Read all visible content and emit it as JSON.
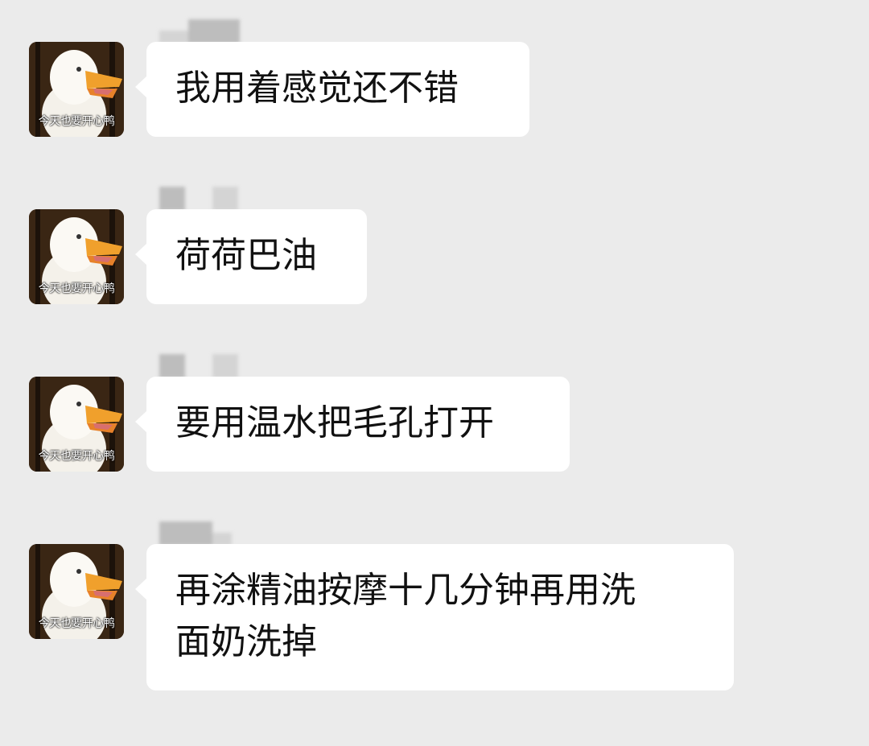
{
  "chat": {
    "messages": [
      {
        "avatar": {
          "caption": "今天也要开心鸭",
          "icon": "duck-avatar-icon"
        },
        "sender_name": "",
        "text": "我用着感觉还不错"
      },
      {
        "avatar": {
          "caption": "今天也要开心鸭",
          "icon": "duck-avatar-icon"
        },
        "sender_name": "",
        "text": "荷荷巴油"
      },
      {
        "avatar": {
          "caption": "今天也要开心鸭",
          "icon": "duck-avatar-icon"
        },
        "sender_name": "",
        "text": "要用温水把毛孔打开"
      },
      {
        "avatar": {
          "caption": "今天也要开心鸭",
          "icon": "duck-avatar-icon"
        },
        "sender_name": "",
        "text": "再涂精油按摩十几分钟再用洗\n面奶洗掉"
      }
    ]
  },
  "colors": {
    "background": "#ebebeb",
    "bubble": "#ffffff",
    "text": "#111111"
  }
}
